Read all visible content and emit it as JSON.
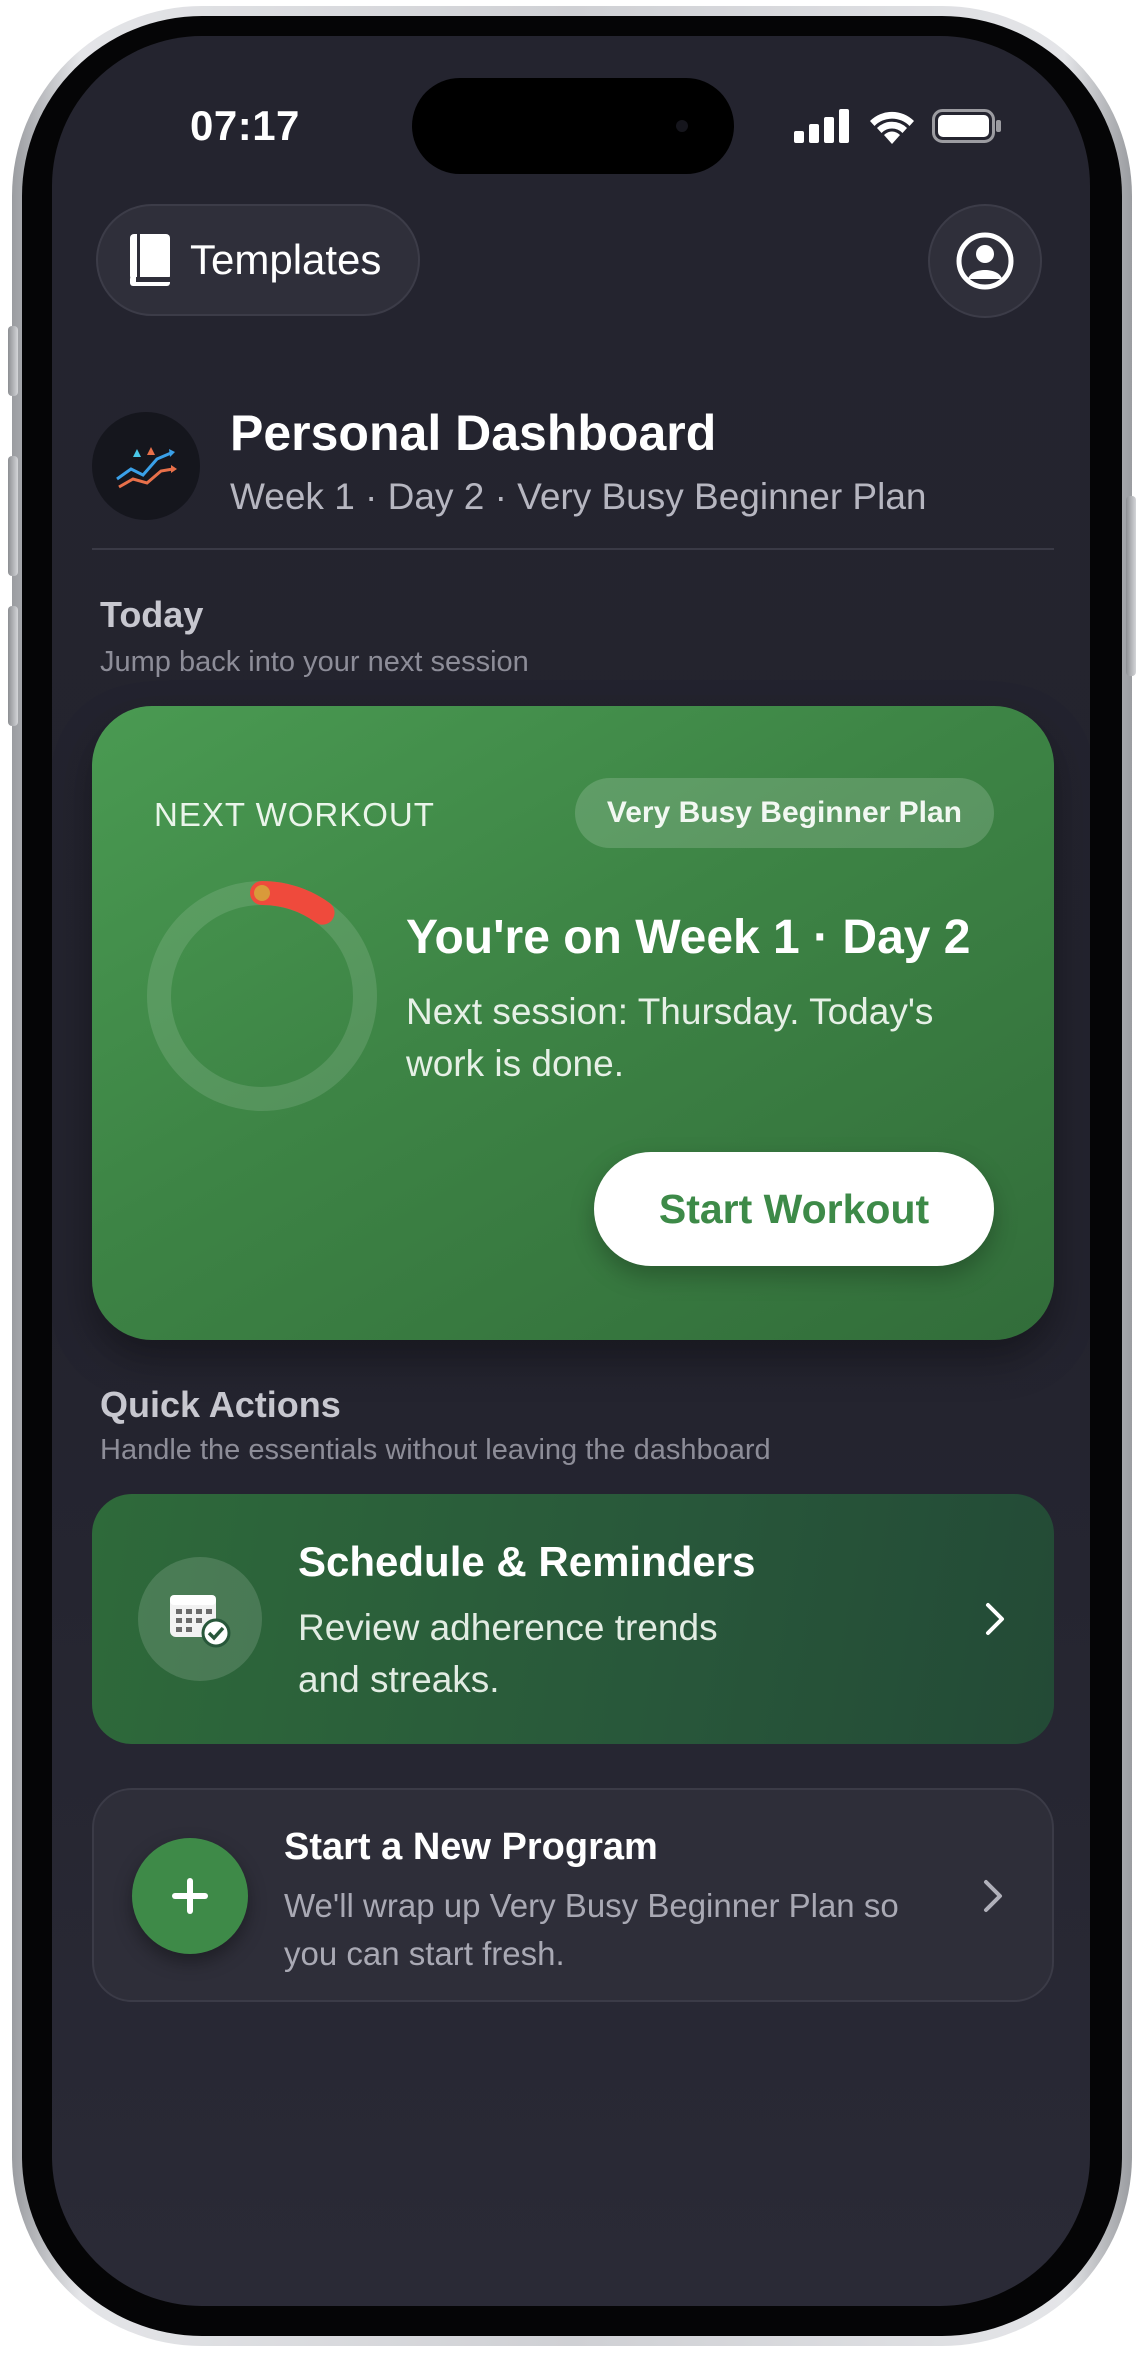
{
  "status_bar": {
    "time": "07:17",
    "icons": [
      "cellular-signal-icon",
      "wifi-icon",
      "battery-icon"
    ]
  },
  "header": {
    "templates_label": "Templates",
    "templates_icon": "book-icon",
    "profile_icon": "person-circle-icon"
  },
  "dashboard": {
    "title": "Personal Dashboard",
    "subtitle": "Week 1 · Day 2 · Very Busy Beginner Plan",
    "logo_icon": "chart-arrows-logo"
  },
  "today": {
    "title": "Today",
    "subtitle": "Jump back into your next session"
  },
  "next_workout": {
    "eyebrow": "NEXT WORKOUT",
    "plan_badge": "Very Busy Beginner Plan",
    "headline": "You're on Week 1 · Day 2",
    "body": "Next session: Thursday. Today's work is done.",
    "start_label": "Start Workout",
    "progress_fraction": 0.1,
    "accent_color": "#3f8b49"
  },
  "quick_actions": {
    "title": "Quick Actions",
    "subtitle": "Handle the essentials without leaving the dashboard",
    "items": [
      {
        "title": "Schedule & Reminders",
        "description": "Review adherence trends and streaks.",
        "icon": "calendar-check-icon"
      },
      {
        "title": "Start a New Program",
        "description": "We'll wrap up Very Busy Beginner Plan so you can start fresh.",
        "icon": "plus-icon"
      }
    ]
  }
}
